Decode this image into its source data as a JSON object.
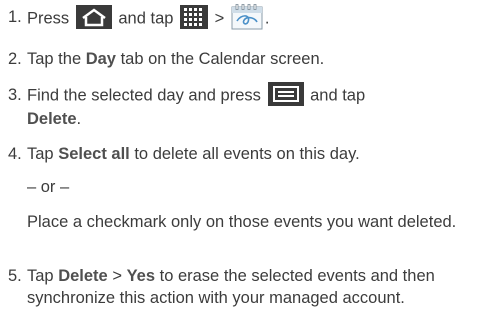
{
  "steps": [
    {
      "num": "1.",
      "t1": "Press",
      "t2": "and tap",
      "t3": ">",
      "t4": ".",
      "icons": [
        "home-key-icon",
        "apps-grid-icon",
        "calendar-app-icon"
      ]
    },
    {
      "num": "2.",
      "t1": "Tap the",
      "b1": "Day",
      "t2": "tab on the Calendar screen."
    },
    {
      "num": "3.",
      "t1": "Find the selected day and press",
      "t2": "and tap",
      "b1": "Delete",
      "t3": ".",
      "icons": [
        "menu-key-icon"
      ]
    },
    {
      "num": "4.",
      "t1": "Tap",
      "b1": "Select all",
      "t2": "to delete all events on this day.",
      "or": "– or –",
      "alt": "Place a checkmark only on those events you want deleted."
    },
    {
      "num": "5.",
      "t1": "Tap",
      "b1": "Delete",
      "t2": ">",
      "b2": "Yes",
      "t3": "to erase the selected events and then synchronize this action with your managed account."
    }
  ],
  "colors": {
    "icon_dark": "#3a3a3a",
    "text": "#3c3c3c",
    "calendar_blue": "#4a90c8"
  }
}
